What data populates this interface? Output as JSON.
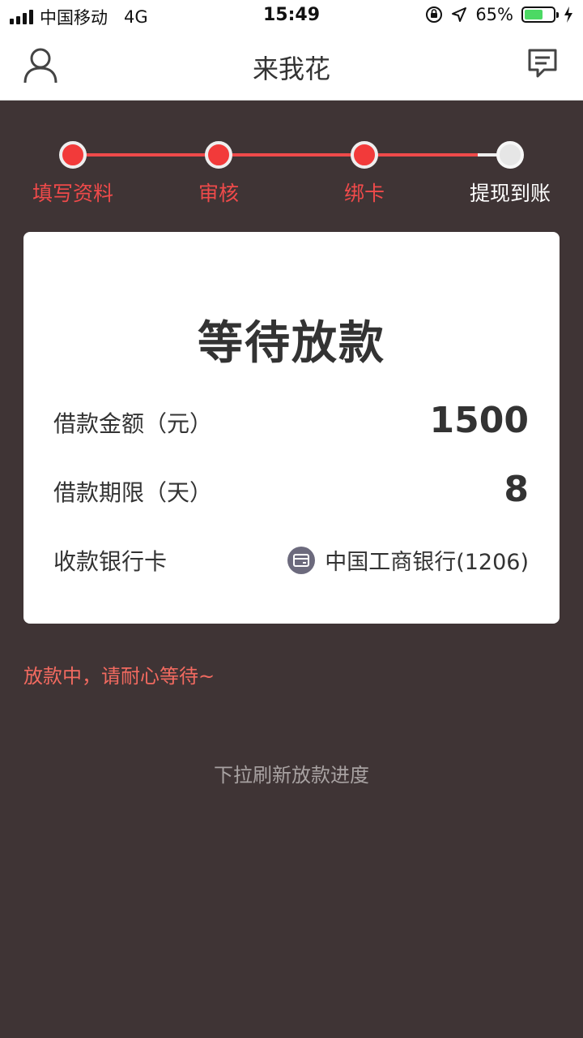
{
  "status_bar": {
    "carrier": "中国移动",
    "network": "4G",
    "time": "15:49",
    "battery_percent": "65%",
    "battery_level": 0.65,
    "icons": [
      "signal-icon",
      "orientation-lock-icon",
      "location-icon",
      "battery-icon",
      "charging-icon"
    ]
  },
  "nav": {
    "title": "来我花",
    "left_icon": "user-icon",
    "right_icon": "message-icon"
  },
  "steps": [
    {
      "label": "填写资料",
      "state": "done"
    },
    {
      "label": "审核",
      "state": "done"
    },
    {
      "label": "绑卡",
      "state": "done"
    },
    {
      "label": "提现到账",
      "state": "pending"
    }
  ],
  "card": {
    "title": "等待放款",
    "amount_label": "借款金额（元）",
    "amount_value": "1500",
    "term_label": "借款期限（天）",
    "term_value": "8",
    "bank_label": "收款银行卡",
    "bank_value": "中国工商银行(1206)",
    "bank_icon": "bank-card-icon"
  },
  "notice": "放款中，请耐心等待~",
  "hint": "下拉刷新放款进度",
  "colors": {
    "background": "#3f3435",
    "accent": "#f23a3a",
    "notice": "#f26a60"
  }
}
